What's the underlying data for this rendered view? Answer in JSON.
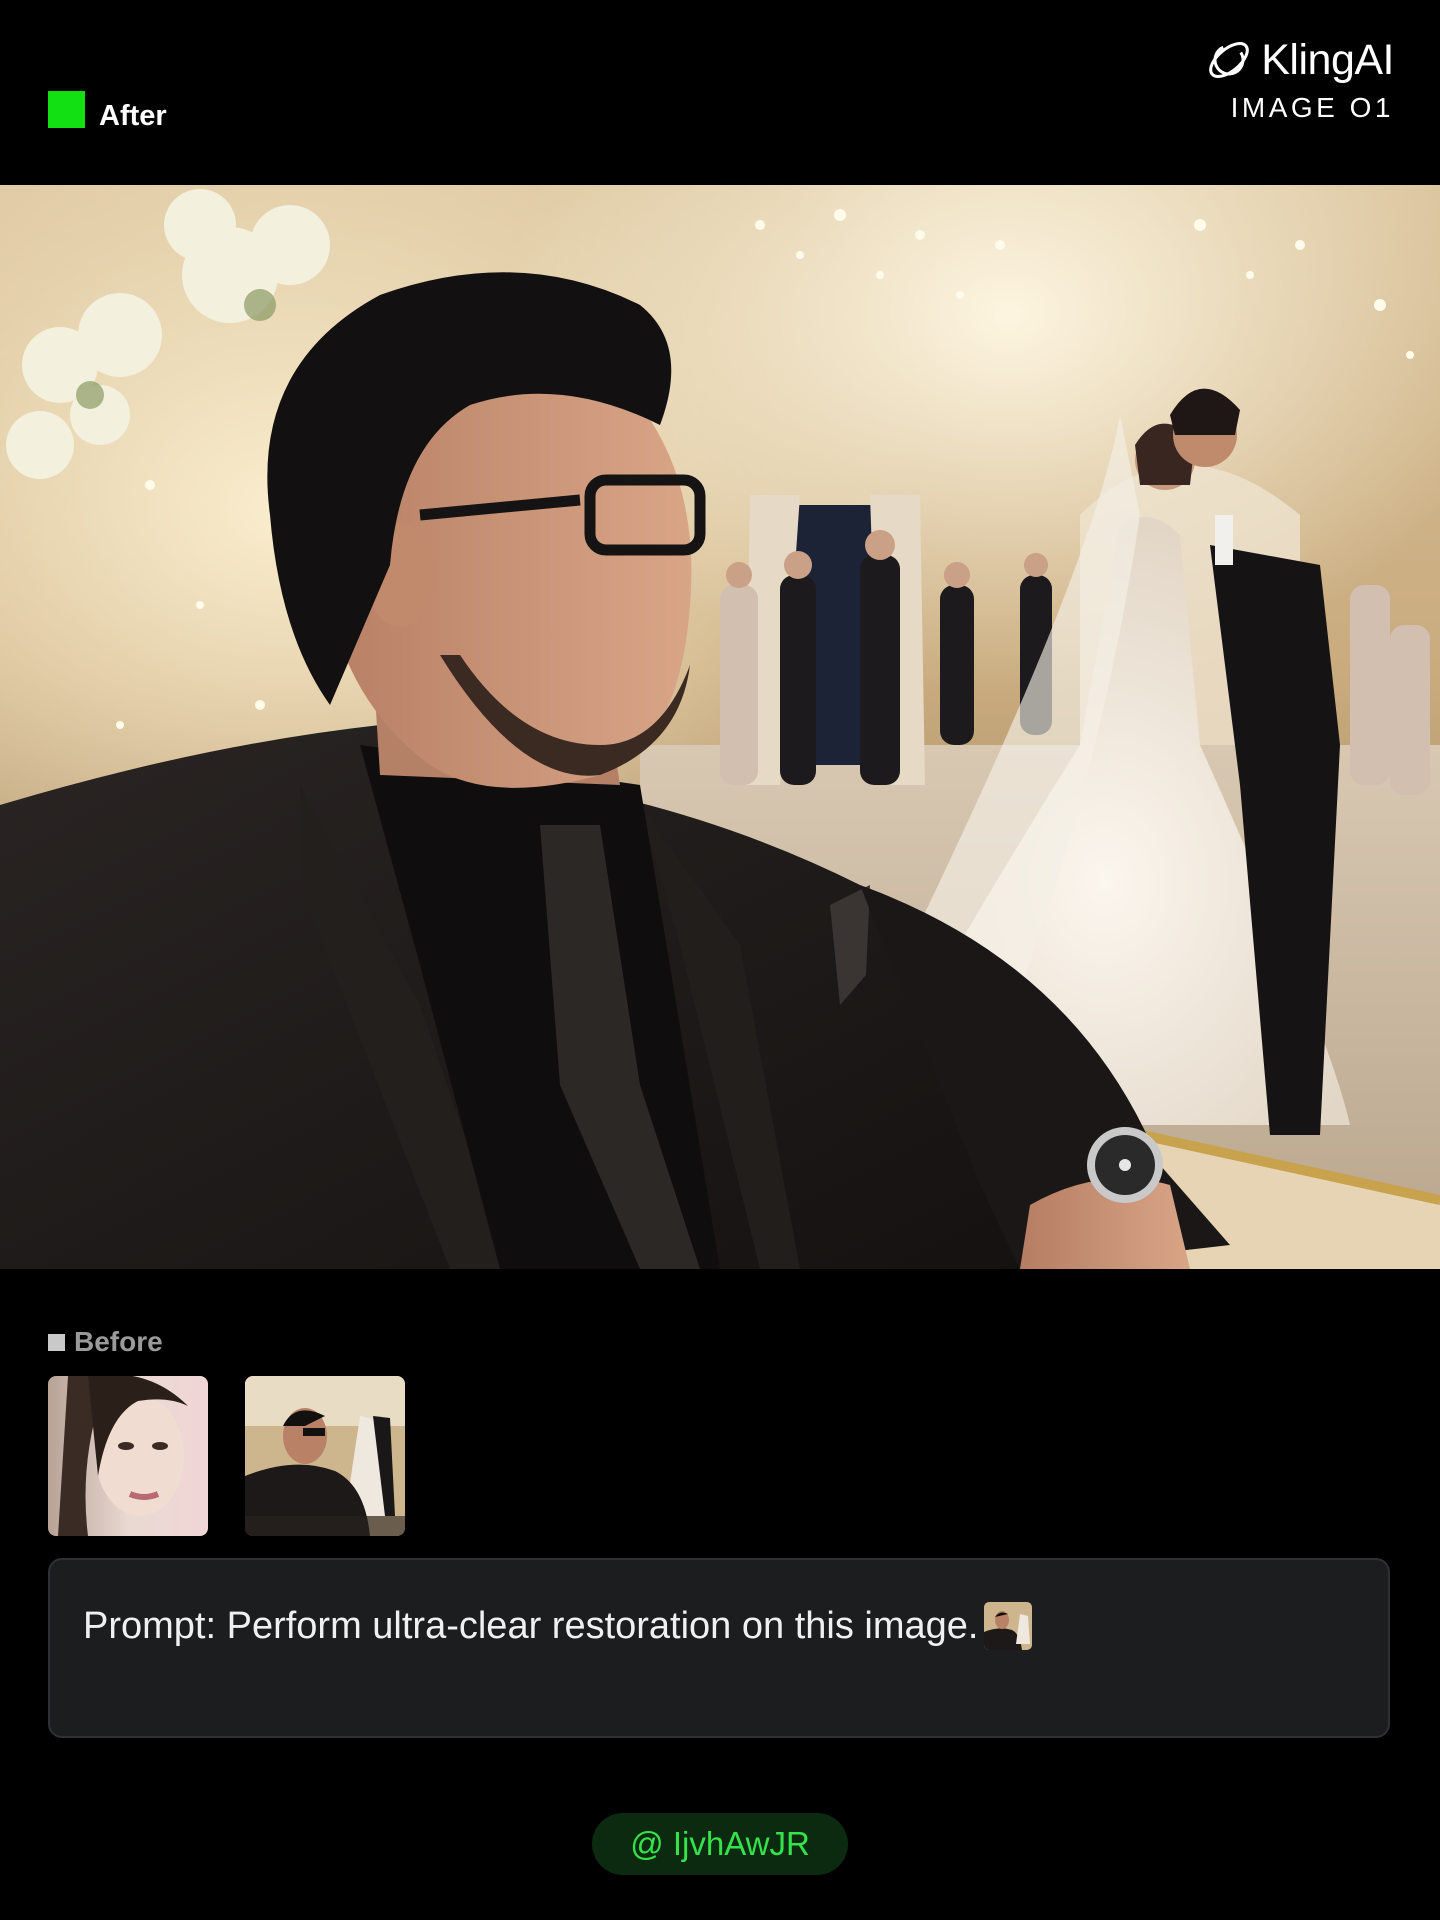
{
  "header": {
    "after_label": "After",
    "brand_name": "KlingAI",
    "brand_sub": "IMAGE O1"
  },
  "colors": {
    "after_accent": "#12e012",
    "prompt_bg": "#1c1d1f",
    "user_tag_bg": "#0c2a10",
    "user_tag_text": "#35e24a"
  },
  "before": {
    "label": "Before",
    "thumbnails": [
      "portrait-woman-thumbnail",
      "wedding-scene-thumbnail"
    ]
  },
  "prompt": {
    "text": "Prompt: Perform ultra-clear restoration on this image."
  },
  "user": {
    "handle": "@ IjvhAwJR"
  }
}
